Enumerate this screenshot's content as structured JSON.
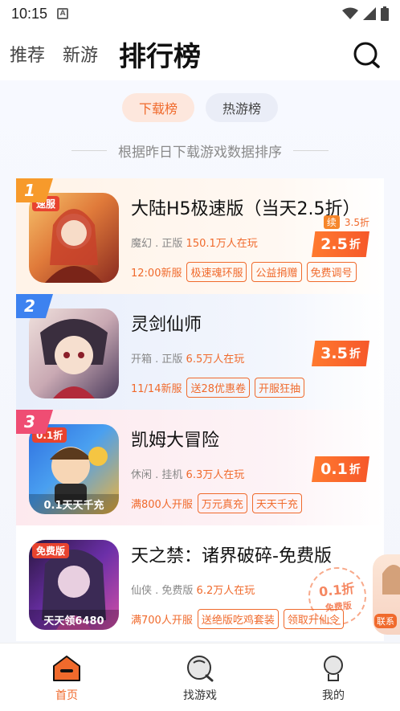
{
  "status_bar": {
    "time": "10:15",
    "badge": "A",
    "icons": [
      "wifi-icon",
      "signal-icon",
      "battery-icon"
    ]
  },
  "top_nav": {
    "tabs": [
      "推荐",
      "新游",
      "排行榜"
    ],
    "active_index": 2,
    "search_icon": "search-icon"
  },
  "sub_tabs": [
    {
      "label": "下载榜",
      "active": true
    },
    {
      "label": "热游榜",
      "active": false
    }
  ],
  "sort_note": "根据昨日下载游戏数据排序",
  "games": [
    {
      "rank": "1",
      "title": "大陆H5极速版（当天2.5折）",
      "category": "魔幻 . 正版",
      "players": "150.1万人在玩",
      "open_time": "12:00新服",
      "tags": [
        "极速魂环服",
        "公益捐赠",
        "免费调号"
      ],
      "discount": "2.5",
      "discount_unit": "折",
      "renew_label": "续",
      "renew_rate": "3.5折",
      "icon_text": "速服",
      "icon_colors": [
        "#f6c26b",
        "#c0392b"
      ]
    },
    {
      "rank": "2",
      "title": "灵剑仙师",
      "category": "开箱 . 正版",
      "players": "6.5万人在玩",
      "open_time": "11/14新服",
      "tags": [
        "送28优惠卷",
        "开服狂抽"
      ],
      "discount": "3.5",
      "discount_unit": "折",
      "icon_text": "",
      "icon_colors": [
        "#e5c9c1",
        "#5a4a6a"
      ]
    },
    {
      "rank": "3",
      "title": "凯姆大冒险",
      "category": "休闲 . 挂机",
      "players": "6.3万人在玩",
      "open_time": "满800人开服",
      "tags": [
        "万元真充",
        "天天千充"
      ],
      "discount": "0.1",
      "discount_unit": "折",
      "icon_text": "0.1天天千充",
      "icon_tag": "0.1折",
      "icon_colors": [
        "#2f6fe0",
        "#f0b33a"
      ]
    },
    {
      "rank": "",
      "title": "天之禁：诸界破碎-免费版",
      "category": "仙侠 . 免费版",
      "players": "6.2万人在玩",
      "open_time": "满700人开服",
      "tags": [
        "送绝版吃鸡套装",
        "领取升仙令"
      ],
      "stamp_top": "0.1折",
      "stamp_bottom": "免费版",
      "icon_text": "天天领6480",
      "icon_tag": "免费版",
      "icon_colors": [
        "#6b2fa8",
        "#d24fa6"
      ]
    }
  ],
  "float_button": {
    "label": "联系"
  },
  "bottom_nav": [
    {
      "label": "首页",
      "icon": "home-icon",
      "active": true
    },
    {
      "label": "找游戏",
      "icon": "find-game-icon",
      "active": false
    },
    {
      "label": "我的",
      "icon": "profile-icon",
      "active": false
    }
  ],
  "colors": {
    "accent": "#f06a2c",
    "rank1": "#f79a2b",
    "rank2": "#3d82f0",
    "rank3": "#ef4d73"
  }
}
